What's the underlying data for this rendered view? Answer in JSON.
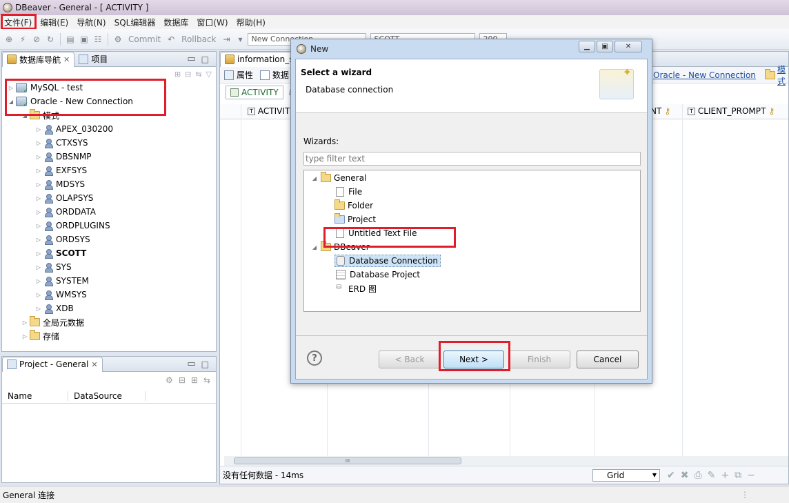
{
  "window": {
    "title": "DBeaver - General - [ ACTIVITY ]"
  },
  "menu": [
    "文件(F)",
    "编辑(E)",
    "导航(N)",
    "SQL编辑器",
    "数据库",
    "窗口(W)",
    "帮助(H)"
  ],
  "toolbar": {
    "commit": "Commit",
    "rollback": "Rollback",
    "connection_combo": "New Connection",
    "schema_combo": "SCOTT",
    "limit": "200"
  },
  "navigator": {
    "tab_label": "数据库导航",
    "tab2_label": "项目",
    "connections": [
      {
        "label": "MySQL - test"
      },
      {
        "label": "Oracle - New Connection"
      }
    ],
    "schema_folder": "模式",
    "schemas": [
      "APEX_030200",
      "CTXSYS",
      "DBSNMP",
      "EXFSYS",
      "MDSYS",
      "OLAPSYS",
      "ORDDATA",
      "ORDPLUGINS",
      "ORDSYS",
      "SCOTT",
      "SYS",
      "SYSTEM",
      "WMSYS",
      "XDB"
    ],
    "global_meta": "全局元数据",
    "storage": "存储"
  },
  "project_panel": {
    "title": "Project - General",
    "columns": [
      "Name",
      "DataSource"
    ]
  },
  "editor": {
    "tab": "information_s",
    "subtabs": {
      "properties": "属性",
      "data": "数据"
    },
    "crumb": "Oracle - New Connection",
    "crumb2": "模式",
    "table_tab": "ACTIVITY",
    "table_tab2": "Er",
    "columns": {
      "c1": "ACTIVITI",
      "c2": "NT",
      "c3": "CLIENT_PROMPT"
    },
    "status": "没有任何数据 - 14ms",
    "view_mode": "Grid",
    "scroll_mark": "III"
  },
  "dialog": {
    "title": "New",
    "header": "Select a wizard",
    "subheader": "Database connection",
    "wizards_label": "Wizards:",
    "filter_placeholder": "type filter text",
    "groups": [
      {
        "label": "General",
        "items": [
          "File",
          "Folder",
          "Project",
          "Untitled Text File"
        ]
      },
      {
        "label": "DBeaver",
        "items": [
          "Database Connection",
          "Database Project",
          "ERD 图"
        ]
      }
    ],
    "buttons": {
      "back": "< Back",
      "next": "Next >",
      "finish": "Finish",
      "cancel": "Cancel"
    },
    "help": "?"
  },
  "statusbar": {
    "text": "General 连接"
  },
  "colors": {
    "highlight_red": "#e01d2a",
    "link_blue": "#1a4fa0",
    "selection_blue": "#cde3f7"
  }
}
